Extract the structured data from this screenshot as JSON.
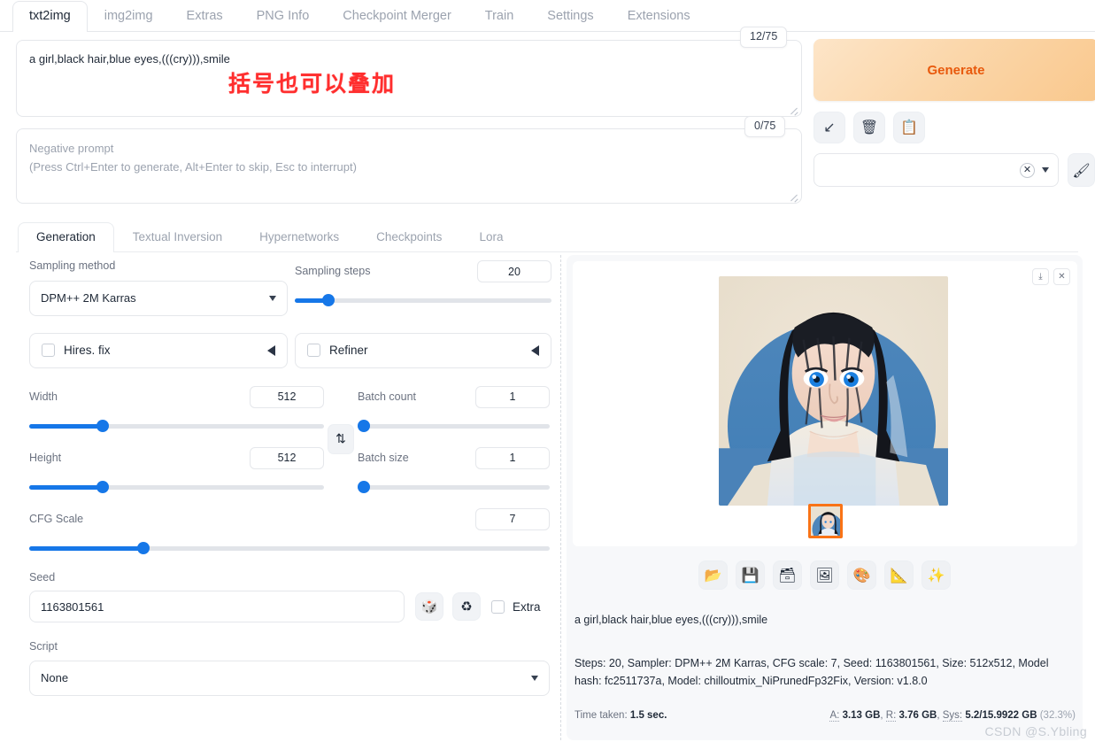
{
  "tabs": {
    "items": [
      {
        "label": "txt2img",
        "active": true
      },
      {
        "label": "img2img",
        "active": false
      },
      {
        "label": "Extras",
        "active": false
      },
      {
        "label": "PNG Info",
        "active": false
      },
      {
        "label": "Checkpoint Merger",
        "active": false
      },
      {
        "label": "Train",
        "active": false
      },
      {
        "label": "Settings",
        "active": false
      },
      {
        "label": "Extensions",
        "active": false
      }
    ]
  },
  "prompt": {
    "value": "a girl,black hair,blue eyes,(((cry))),smile",
    "token_counter": "12/75",
    "overlay_note": "括号也可以叠加"
  },
  "negative_prompt": {
    "placeholder_line1": "Negative prompt",
    "placeholder_line2": "(Press Ctrl+Enter to generate, Alt+Enter to skip, Esc to interrupt)",
    "token_counter": "0/75"
  },
  "generate": {
    "label": "Generate",
    "accent_color": "#e8590c",
    "mini_buttons": [
      {
        "name": "paste-params-icon",
        "glyph": "↙"
      },
      {
        "name": "clear-prompt-icon",
        "glyph": "🗑"
      },
      {
        "name": "apply-style-icon",
        "glyph": "📋"
      }
    ],
    "styles_value": "",
    "brush_icon": "🖌"
  },
  "subtabs": {
    "items": [
      {
        "label": "Generation",
        "active": true
      },
      {
        "label": "Textual Inversion",
        "active": false
      },
      {
        "label": "Hypernetworks",
        "active": false
      },
      {
        "label": "Checkpoints",
        "active": false
      },
      {
        "label": "Lora",
        "active": false
      }
    ]
  },
  "settings": {
    "sampling_method": {
      "label": "Sampling method",
      "value": "DPM++ 2M Karras"
    },
    "sampling_steps": {
      "label": "Sampling steps",
      "value": "20",
      "percent": 13
    },
    "hires_fix": {
      "label": "Hires. fix",
      "checked": false
    },
    "refiner": {
      "label": "Refiner",
      "checked": false
    },
    "width": {
      "label": "Width",
      "value": "512",
      "percent": 25
    },
    "height": {
      "label": "Height",
      "value": "512",
      "percent": 25
    },
    "cfg_scale": {
      "label": "CFG Scale",
      "value": "7",
      "percent": 22
    },
    "batch_count": {
      "label": "Batch count",
      "value": "1",
      "percent": 0
    },
    "batch_size": {
      "label": "Batch size",
      "value": "1",
      "percent": 0
    },
    "swap_icon": "⇅",
    "seed": {
      "label": "Seed",
      "value": "1163801561"
    },
    "seed_random_icon": "🎲",
    "seed_reuse_icon": "♻",
    "seed_extra": {
      "label": "Extra",
      "checked": false
    },
    "script": {
      "label": "Script",
      "value": "None"
    }
  },
  "results": {
    "gallery_tools": [
      {
        "name": "download-icon",
        "glyph": "⤓"
      },
      {
        "name": "close-icon",
        "glyph": "✕"
      }
    ],
    "image_tools": [
      {
        "name": "open-folder-icon",
        "glyph": "📂"
      },
      {
        "name": "save-icon",
        "glyph": "💾"
      },
      {
        "name": "save-zip-icon",
        "glyph": "🗃"
      },
      {
        "name": "send-to-img2img-icon",
        "glyph": "🖼"
      },
      {
        "name": "send-to-inpaint-icon",
        "glyph": "🎨"
      },
      {
        "name": "send-to-extras-icon",
        "glyph": "📐"
      },
      {
        "name": "sparkles-icon",
        "glyph": "✨"
      }
    ],
    "info_prompt": "a girl,black hair,blue eyes,(((cry))),smile",
    "info_params": "Steps: 20, Sampler: DPM++ 2M Karras, CFG scale: 7, Seed: 1163801561, Size: 512x512, Model hash: fc2511737a, Model: chilloutmix_NiPrunedFp32Fix, Version: v1.8.0",
    "time_taken_label": "Time taken:",
    "time_taken_value": "1.5 sec.",
    "mem_a_label": "A:",
    "mem_a_value": "3.13 GB",
    "mem_r_label": "R:",
    "mem_r_value": "3.76 GB",
    "mem_sys_label": "Sys:",
    "mem_sys_value": "5.2/15.9922 GB",
    "mem_sys_percent": "(32.3%)"
  },
  "watermark": "CSDN @S.Ybling"
}
